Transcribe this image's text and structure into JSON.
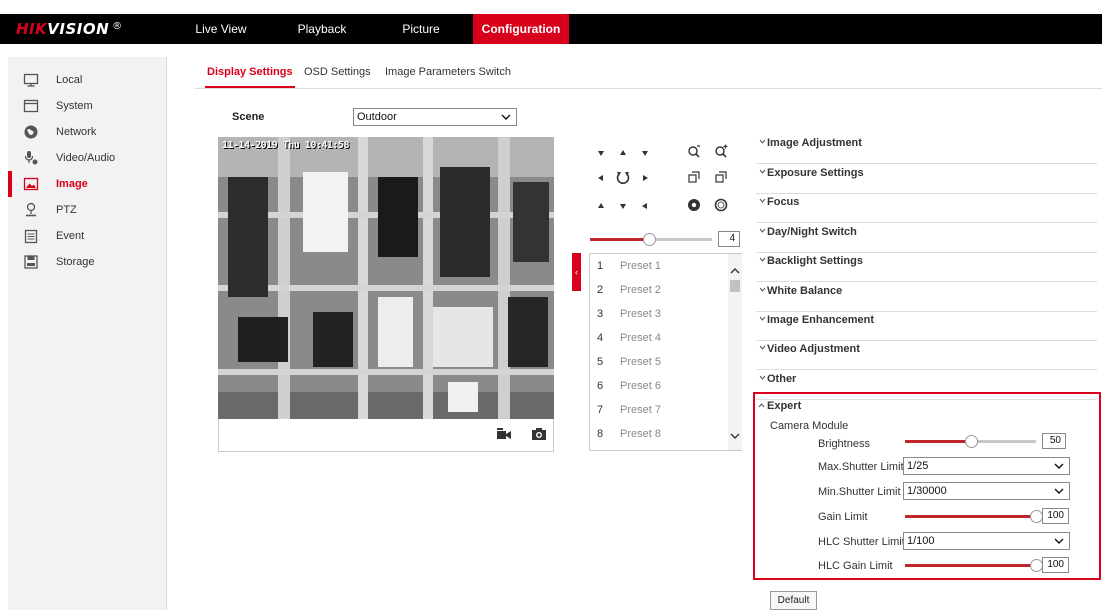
{
  "header": {
    "logo_brand": "HIKVISION",
    "logo_mark": "®",
    "nav": [
      "Live View",
      "Playback",
      "Picture",
      "Configuration"
    ]
  },
  "sidebar": {
    "items": [
      {
        "label": "Local",
        "icon": "monitor-icon"
      },
      {
        "label": "System",
        "icon": "window-icon"
      },
      {
        "label": "Network",
        "icon": "globe-icon"
      },
      {
        "label": "Video/Audio",
        "icon": "microphone-icon"
      },
      {
        "label": "Image",
        "icon": "image-icon"
      },
      {
        "label": "PTZ",
        "icon": "ptz-icon"
      },
      {
        "label": "Event",
        "icon": "calendar-icon"
      },
      {
        "label": "Storage",
        "icon": "storage-icon"
      }
    ],
    "active": "Image"
  },
  "subtabs": [
    "Display Settings",
    "OSD Settings",
    "Image Parameters Switch"
  ],
  "scene": {
    "label": "Scene",
    "value": "Outdoor"
  },
  "video": {
    "osd_time": "11-14-2019 Thu 10:41:58"
  },
  "ptz": {
    "speed": "4",
    "speed_fraction": 0.48
  },
  "presets": [
    {
      "num": "1",
      "name": "Preset 1"
    },
    {
      "num": "2",
      "name": "Preset 2"
    },
    {
      "num": "3",
      "name": "Preset 3"
    },
    {
      "num": "4",
      "name": "Preset 4"
    },
    {
      "num": "5",
      "name": "Preset 5"
    },
    {
      "num": "6",
      "name": "Preset 6"
    },
    {
      "num": "7",
      "name": "Preset 7"
    },
    {
      "num": "8",
      "name": "Preset 8"
    }
  ],
  "accordion": [
    "Image Adjustment",
    "Exposure Settings",
    "Focus",
    "Day/Night Switch",
    "Backlight Settings",
    "White Balance",
    "Image Enhancement",
    "Video Adjustment",
    "Other"
  ],
  "expert": {
    "title": "Expert",
    "module": "Camera Module",
    "brightness": {
      "label": "Brightness",
      "value": "50",
      "fraction": 0.5
    },
    "max_shutter": {
      "label": "Max.Shutter Limit",
      "value": "1/25"
    },
    "min_shutter": {
      "label": "Min.Shutter Limit",
      "value": "1/30000"
    },
    "gain_limit": {
      "label": "Gain Limit",
      "value": "100",
      "fraction": 1.0
    },
    "hlc_shutter": {
      "label": "HLC Shutter Limit",
      "value": "1/100"
    },
    "hlc_gain": {
      "label": "HLC Gain Limit",
      "value": "100",
      "fraction": 1.0
    }
  },
  "default_button": "Default",
  "colors": {
    "accent": "#d9001b",
    "slider_fill": "#c0272d"
  }
}
